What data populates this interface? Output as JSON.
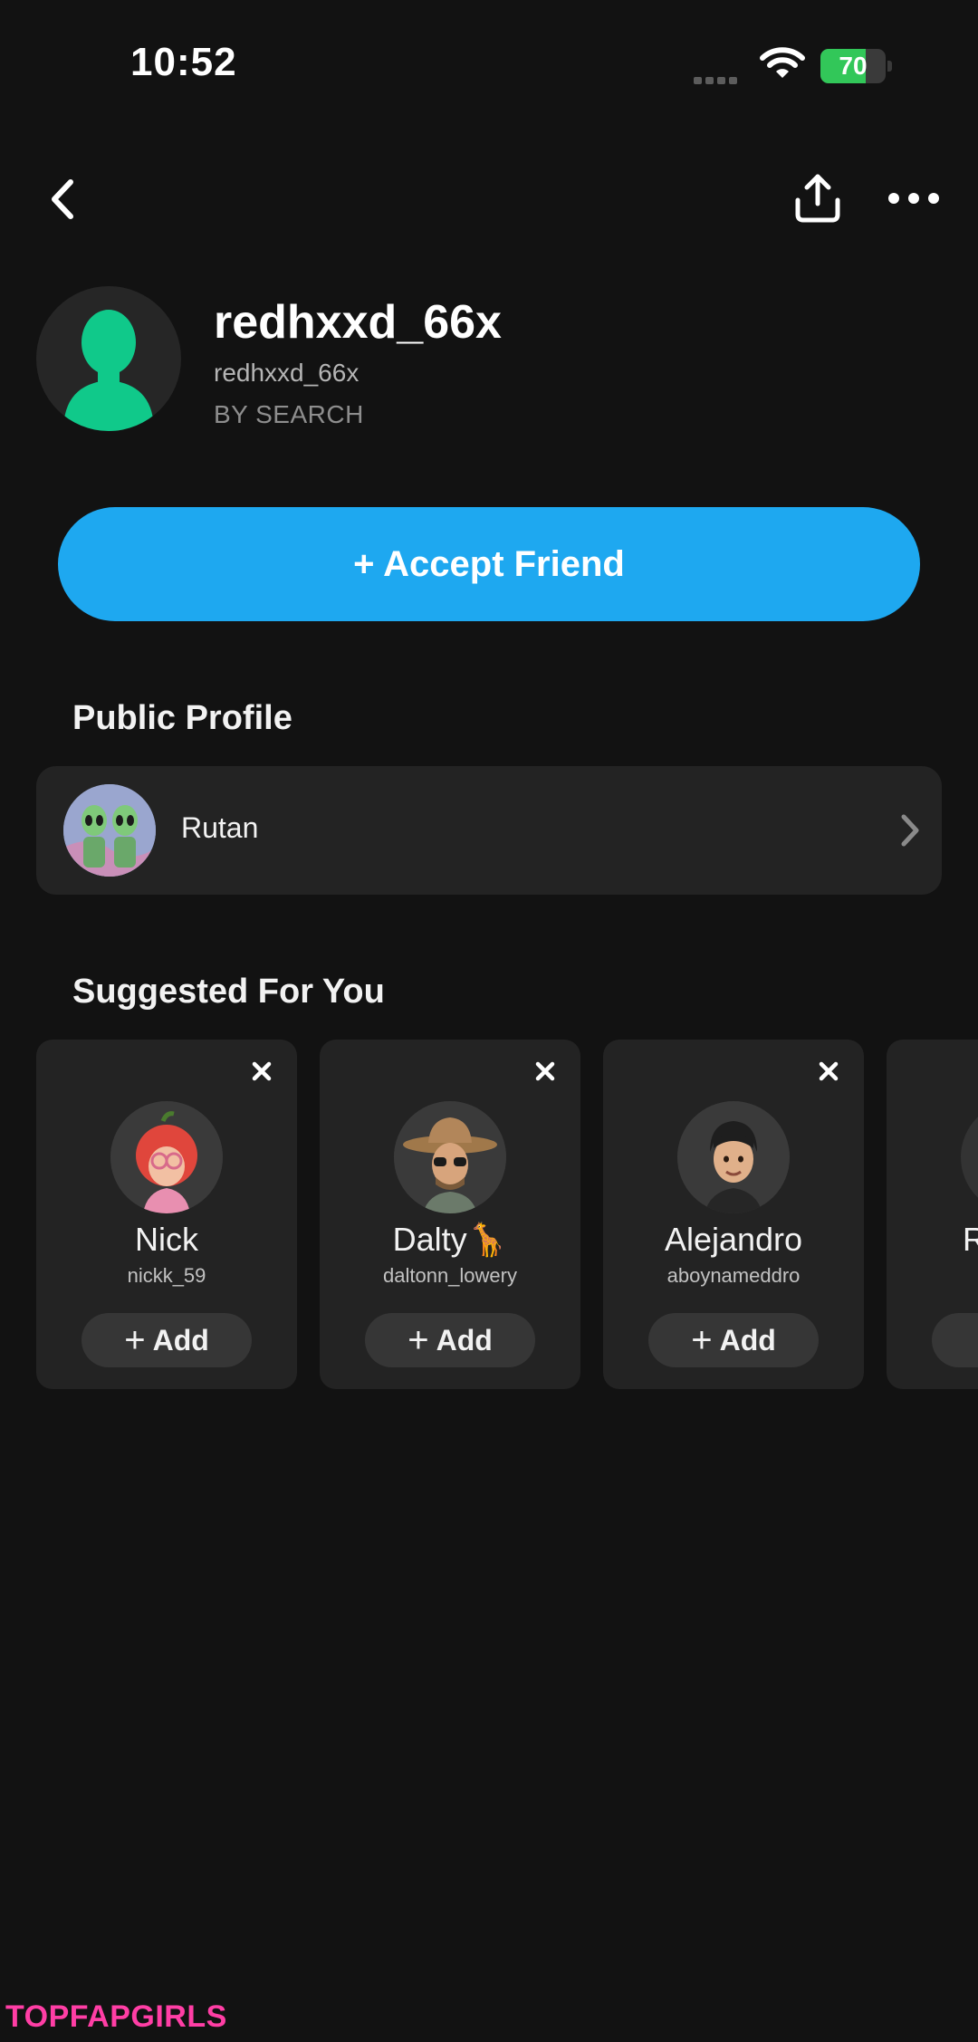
{
  "status_bar": {
    "time": "10:52",
    "battery_percent": 70,
    "battery_label": "70",
    "battery_color": "#32c759",
    "icons": [
      "signal-dots-icon",
      "wifi-icon",
      "battery-charging-icon"
    ]
  },
  "nav": {
    "icons": [
      "back-chevron-icon",
      "share-upload-icon",
      "more-dots-icon"
    ]
  },
  "profile": {
    "display_name": "redhxxd_66x",
    "username": "redhxxd_66x",
    "added_by": "BY SEARCH",
    "avatar_color": "#10c98a"
  },
  "accept_button": {
    "label": "+ Accept Friend",
    "color": "#1ea8f0"
  },
  "public_profile": {
    "section_title": "Public Profile",
    "name": "Rutan"
  },
  "suggested": {
    "section_title": "Suggested For You",
    "add_label": "Add",
    "cards": [
      {
        "name": "Nick",
        "username": "nickk_59",
        "avatar": "apple-head-bitmoji"
      },
      {
        "name": "Dalty🦒",
        "username": "daltonn_lowery",
        "avatar": "cowboy-hat-bitmoji"
      },
      {
        "name": "Alejandro",
        "username": "aboynameddro",
        "avatar": "dark-hair-bitmoji"
      },
      {
        "name": "R",
        "username": "",
        "avatar": "partial-bitmoji"
      }
    ]
  },
  "watermark": "TOPFAPGIRLS"
}
